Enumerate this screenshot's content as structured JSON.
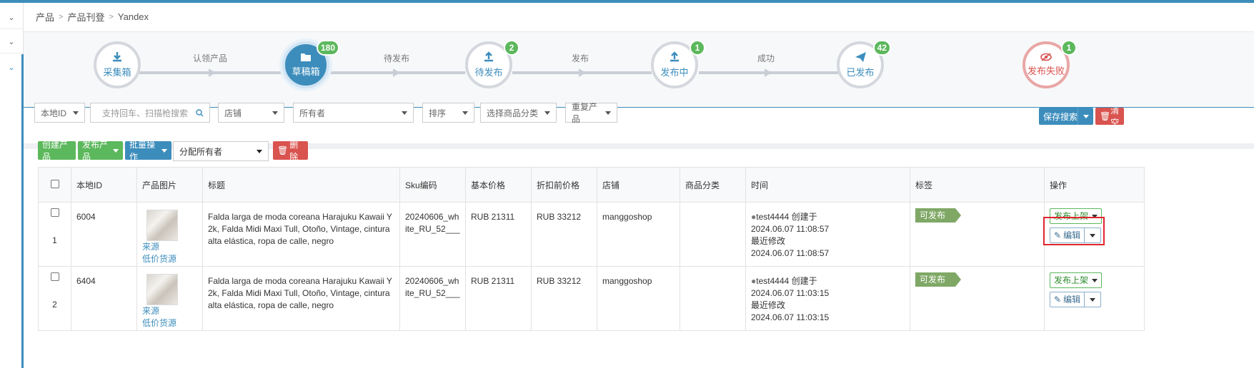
{
  "breadcrumb": [
    "产品",
    "产品刊登",
    "Yandex"
  ],
  "pipeline": {
    "stages": [
      {
        "label": "采集箱",
        "badge": "",
        "icon": "download-icon"
      },
      {
        "label": "草稿箱",
        "badge": "180",
        "icon": "folder-icon"
      },
      {
        "label": "待发布",
        "badge": "2",
        "icon": "upload-icon"
      },
      {
        "label": "发布中",
        "badge": "1",
        "icon": "upload-icon"
      },
      {
        "label": "已发布",
        "badge": "42",
        "icon": "paper-plane-icon"
      },
      {
        "label": "发布失败",
        "badge": "1",
        "icon": "eye-slash-icon"
      }
    ],
    "transitions": [
      "认领产品",
      "待发布",
      "发布",
      "成功"
    ]
  },
  "filters": {
    "local_id": "本地ID",
    "search_placeholder": "支持回车、扫描枪搜索",
    "shop": "店铺",
    "owner": "所有者",
    "sort": "排序",
    "category": "选择商品分类",
    "duplicate": "重复产品",
    "save_search": "保存搜索",
    "clear": "清空"
  },
  "toolbar": {
    "create": "创建产品",
    "publish": "发布产品",
    "batch": "批量操作",
    "assign": "分配所有者",
    "delete": "删除"
  },
  "table": {
    "headers": [
      "本地ID",
      "产品图片",
      "标题",
      "Sku编码",
      "基本价格",
      "折扣前价格",
      "店铺",
      "商品分类",
      "时间",
      "标签",
      "操作"
    ],
    "rows": [
      {
        "index": "1",
        "local_id": "6004",
        "source": "来源",
        "low_price": "低价货源",
        "title": "Falda larga de moda coreana Harajuku Kawaii Y2k, Falda Midi Maxi Tull, Otoño, Vintage, cintura alta elástica, ropa de calle, negro",
        "sku": "20240606_white_RU_52___",
        "base_price": "RUB 21311",
        "pre_discount": "RUB 33212",
        "shop": "manggoshop",
        "category": "",
        "creator": "test4444 创建于",
        "created": "2024.06.07 11:08:57",
        "modified_label": "最近修改",
        "modified": "2024.06.07 11:08:57",
        "tag": "可发布",
        "publish_action": "发布上架",
        "edit_action": "编辑"
      },
      {
        "index": "2",
        "local_id": "6404",
        "source": "来源",
        "low_price": "低价货源",
        "title": "Falda larga de moda coreana Harajuku Kawaii Y2k, Falda Midi Maxi Tull, Otoño, Vintage, cintura alta elástica, ropa de calle, negro",
        "sku": "20240606_white_RU_52___",
        "base_price": "RUB 21311",
        "pre_discount": "RUB 33212",
        "shop": "manggoshop",
        "category": "",
        "creator": "test4444 创建于",
        "created": "2024.06.07 11:03:15",
        "modified_label": "最近修改",
        "modified": "2024.06.07 11:03:15",
        "tag": "可发布",
        "publish_action": "发布上架",
        "edit_action": "编辑"
      }
    ]
  },
  "colors": {
    "primary": "#3c8dbc",
    "success": "#5cb85c",
    "danger": "#d9534f",
    "tag": "#7fa866"
  }
}
